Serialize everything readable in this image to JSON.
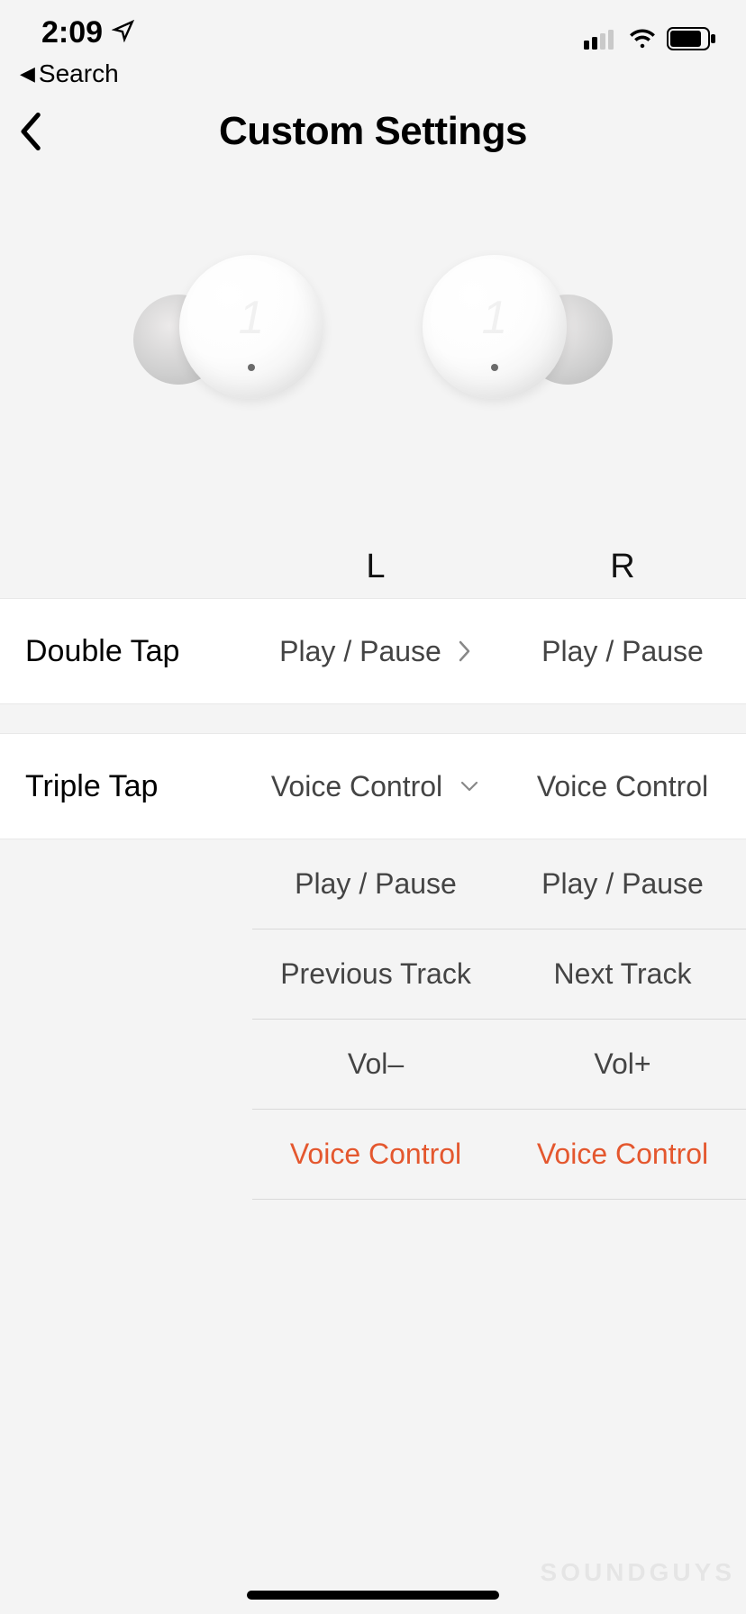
{
  "status": {
    "time": "2:09",
    "nav_icon": "location-arrow-icon",
    "signal_bars": 2,
    "wifi": true,
    "battery_pct": 78
  },
  "breadcrumb": {
    "back_label": "Search"
  },
  "header": {
    "title": "Custom Settings"
  },
  "columns": {
    "left_label": "L",
    "right_label": "R"
  },
  "gestures": [
    {
      "id": "double_tap",
      "label": "Double Tap",
      "left_value": "Play / Pause",
      "right_value": "Play / Pause",
      "expanded": false
    },
    {
      "id": "triple_tap",
      "label": "Triple Tap",
      "left_value": "Voice Control",
      "right_value": "Voice Control",
      "expanded": true,
      "options": {
        "left": [
          "Play / Pause",
          "Previous Track",
          "Vol–",
          "Voice Control"
        ],
        "right": [
          "Play / Pause",
          "Next Track",
          "Vol+",
          "Voice Control"
        ],
        "selected_left": "Voice Control",
        "selected_right": "Voice Control"
      }
    }
  ],
  "watermark": "SOUNDGUYS",
  "colors": {
    "accent": "#e4572e",
    "bg": "#f4f4f4",
    "row_bg": "#ffffff",
    "divider": "#e8e8e8",
    "text_primary": "#000000",
    "text_secondary": "#444444"
  }
}
